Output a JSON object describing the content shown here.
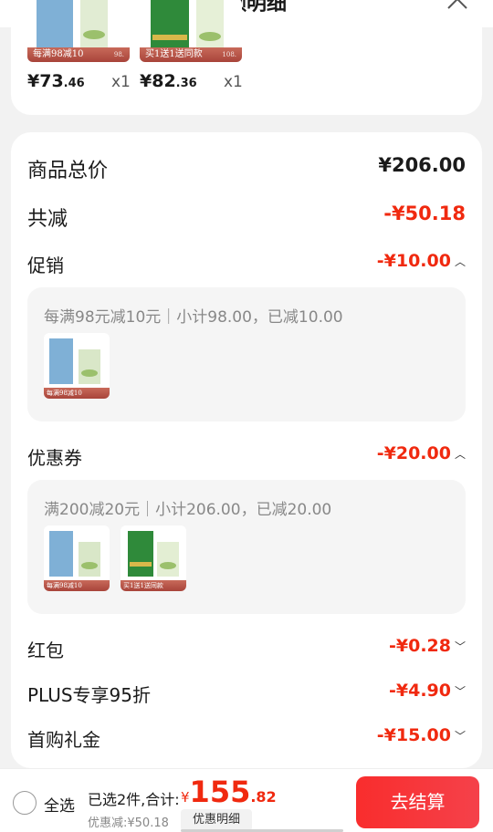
{
  "header": {
    "title": "金额明细"
  },
  "items": [
    {
      "badge": "每满98减10",
      "badge_sub": "98.",
      "price_int": "¥73",
      "price_dec": ".46",
      "qty": "x1"
    },
    {
      "badge": "买1送1送同款",
      "badge_sub": "108.",
      "price_int": "¥82",
      "price_dec": ".36",
      "qty": "x1"
    }
  ],
  "summary": {
    "goods_total": {
      "label": "商品总价",
      "value": "¥206.00"
    },
    "total_reduce": {
      "label": "共减",
      "value": "-¥50.18"
    },
    "promotion": {
      "label": "促销",
      "value": "-¥10.00",
      "detail": "每满98元减10元｜小计98.00，已减10.00",
      "products": [
        {
          "badge": "每满98减10",
          "badge_sub": "98."
        }
      ]
    },
    "coupon": {
      "label": "优惠券",
      "value": "-¥20.00",
      "detail": "满200减20元｜小计206.00，已减20.00",
      "products": [
        {
          "badge": "每满98减10",
          "badge_sub": "98."
        },
        {
          "badge": "买1送1送同款",
          "badge_sub": "108."
        }
      ]
    },
    "red_packet": {
      "label": "红包",
      "value": "-¥0.28"
    },
    "plus": {
      "label": "PLUS专享95折",
      "value": "-¥4.90"
    },
    "first_gift": {
      "label": "首购礼金",
      "value": "-¥15.00"
    }
  },
  "bottom": {
    "select_all": "全选",
    "selected_text": "已选2件,合计:",
    "currency": "¥",
    "total_int": "155",
    "total_dec": ".82",
    "discount_text": "优惠减:¥50.18",
    "detail_btn": "优惠明细",
    "checkout_btn": "去结算"
  },
  "colors": {
    "accent": "#f0290f",
    "checkout": "#f92d2d",
    "card": "#ffffff",
    "bg": "#f2f2f2"
  }
}
